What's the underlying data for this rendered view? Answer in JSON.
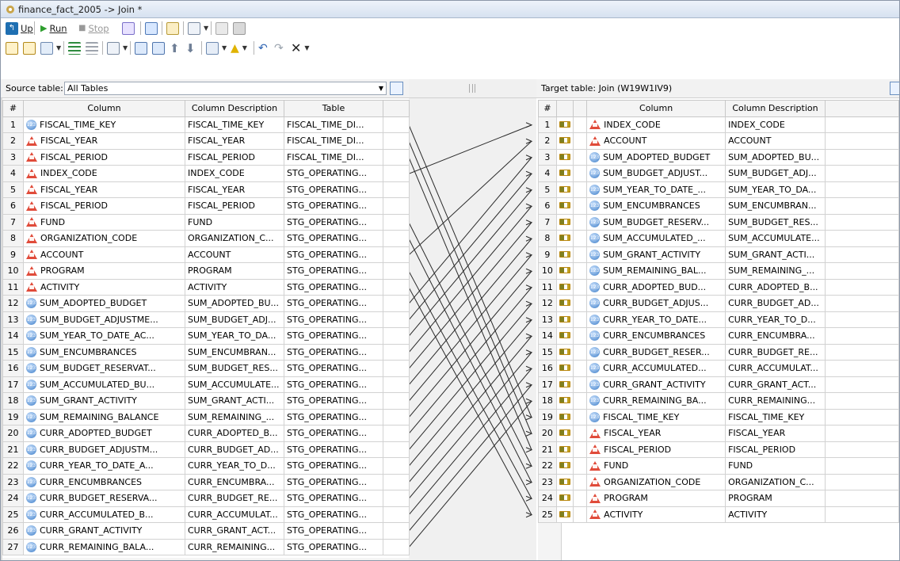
{
  "window": {
    "title": "finance_fact_2005 -> Join *"
  },
  "toolbar1": {
    "up": "Up",
    "run": "Run",
    "stop": "Stop"
  },
  "source": {
    "label": "Source table:",
    "value": "All Tables"
  },
  "target": {
    "label": "Target table:",
    "value": "Join (W19W1IV9)"
  },
  "left_headers": [
    "#",
    "Column",
    "Column Description",
    "Table"
  ],
  "right_headers": [
    "#",
    "",
    "",
    "Column",
    "Column Description"
  ],
  "left_rows": [
    {
      "n": "1",
      "icon": "numeric-icon",
      "col": "FISCAL_TIME_KEY",
      "desc": "FISCAL_TIME_KEY",
      "table": "FISCAL_TIME_DI..."
    },
    {
      "n": "2",
      "icon": "char-icon",
      "col": "FISCAL_YEAR",
      "desc": "FISCAL_YEAR",
      "table": "FISCAL_TIME_DI..."
    },
    {
      "n": "3",
      "icon": "char-icon",
      "col": "FISCAL_PERIOD",
      "desc": "FISCAL_PERIOD",
      "table": "FISCAL_TIME_DI..."
    },
    {
      "n": "4",
      "icon": "char-icon",
      "col": "INDEX_CODE",
      "desc": "INDEX_CODE",
      "table": "STG_OPERATING..."
    },
    {
      "n": "5",
      "icon": "char-icon",
      "col": "FISCAL_YEAR",
      "desc": "FISCAL_YEAR",
      "table": "STG_OPERATING..."
    },
    {
      "n": "6",
      "icon": "char-icon",
      "col": "FISCAL_PERIOD",
      "desc": "FISCAL_PERIOD",
      "table": "STG_OPERATING..."
    },
    {
      "n": "7",
      "icon": "char-icon",
      "col": "FUND",
      "desc": "FUND",
      "table": "STG_OPERATING..."
    },
    {
      "n": "8",
      "icon": "char-icon",
      "col": "ORGANIZATION_CODE",
      "desc": "ORGANIZATION_C...",
      "table": "STG_OPERATING..."
    },
    {
      "n": "9",
      "icon": "char-icon",
      "col": "ACCOUNT",
      "desc": "ACCOUNT",
      "table": "STG_OPERATING..."
    },
    {
      "n": "10",
      "icon": "char-icon",
      "col": "PROGRAM",
      "desc": "PROGRAM",
      "table": "STG_OPERATING..."
    },
    {
      "n": "11",
      "icon": "char-icon",
      "col": "ACTIVITY",
      "desc": "ACTIVITY",
      "table": "STG_OPERATING..."
    },
    {
      "n": "12",
      "icon": "numeric-icon",
      "col": "SUM_ADOPTED_BUDGET",
      "desc": "SUM_ADOPTED_BU...",
      "table": "STG_OPERATING..."
    },
    {
      "n": "13",
      "icon": "numeric-icon",
      "col": "SUM_BUDGET_ADJUSTME...",
      "desc": "SUM_BUDGET_ADJ...",
      "table": "STG_OPERATING..."
    },
    {
      "n": "14",
      "icon": "numeric-icon",
      "col": "SUM_YEAR_TO_DATE_AC...",
      "desc": "SUM_YEAR_TO_DA...",
      "table": "STG_OPERATING..."
    },
    {
      "n": "15",
      "icon": "numeric-icon",
      "col": "SUM_ENCUMBRANCES",
      "desc": "SUM_ENCUMBRAN...",
      "table": "STG_OPERATING..."
    },
    {
      "n": "16",
      "icon": "numeric-icon",
      "col": "SUM_BUDGET_RESERVAT...",
      "desc": "SUM_BUDGET_RES...",
      "table": "STG_OPERATING..."
    },
    {
      "n": "17",
      "icon": "numeric-icon",
      "col": "SUM_ACCUMULATED_BU...",
      "desc": "SUM_ACCUMULATE...",
      "table": "STG_OPERATING..."
    },
    {
      "n": "18",
      "icon": "numeric-icon",
      "col": "SUM_GRANT_ACTIVITY",
      "desc": "SUM_GRANT_ACTI...",
      "table": "STG_OPERATING..."
    },
    {
      "n": "19",
      "icon": "numeric-icon",
      "col": "SUM_REMAINING_BALANCE",
      "desc": "SUM_REMAINING_...",
      "table": "STG_OPERATING..."
    },
    {
      "n": "20",
      "icon": "numeric-icon",
      "col": "CURR_ADOPTED_BUDGET",
      "desc": "CURR_ADOPTED_B...",
      "table": "STG_OPERATING..."
    },
    {
      "n": "21",
      "icon": "numeric-icon",
      "col": "CURR_BUDGET_ADJUSTM...",
      "desc": "CURR_BUDGET_AD...",
      "table": "STG_OPERATING..."
    },
    {
      "n": "22",
      "icon": "numeric-icon",
      "col": "CURR_YEAR_TO_DATE_A...",
      "desc": "CURR_YEAR_TO_D...",
      "table": "STG_OPERATING..."
    },
    {
      "n": "23",
      "icon": "numeric-icon",
      "col": "CURR_ENCUMBRANCES",
      "desc": "CURR_ENCUMBRA...",
      "table": "STG_OPERATING..."
    },
    {
      "n": "24",
      "icon": "numeric-icon",
      "col": "CURR_BUDGET_RESERVA...",
      "desc": "CURR_BUDGET_RE...",
      "table": "STG_OPERATING..."
    },
    {
      "n": "25",
      "icon": "numeric-icon",
      "col": "CURR_ACCUMULATED_B...",
      "desc": "CURR_ACCUMULAT...",
      "table": "STG_OPERATING..."
    },
    {
      "n": "26",
      "icon": "numeric-icon",
      "col": "CURR_GRANT_ACTIVITY",
      "desc": "CURR_GRANT_ACT...",
      "table": "STG_OPERATING..."
    },
    {
      "n": "27",
      "icon": "numeric-icon",
      "col": "CURR_REMAINING_BALA...",
      "desc": "CURR_REMAINING...",
      "table": "STG_OPERATING..."
    }
  ],
  "right_rows": [
    {
      "n": "1",
      "icon": "char-icon",
      "col": "INDEX_CODE",
      "desc": "INDEX_CODE"
    },
    {
      "n": "2",
      "icon": "char-icon",
      "col": "ACCOUNT",
      "desc": "ACCOUNT"
    },
    {
      "n": "3",
      "icon": "numeric-icon",
      "col": "SUM_ADOPTED_BUDGET",
      "desc": "SUM_ADOPTED_BU..."
    },
    {
      "n": "4",
      "icon": "numeric-icon",
      "col": "SUM_BUDGET_ADJUST...",
      "desc": "SUM_BUDGET_ADJ..."
    },
    {
      "n": "5",
      "icon": "numeric-icon",
      "col": "SUM_YEAR_TO_DATE_...",
      "desc": "SUM_YEAR_TO_DA..."
    },
    {
      "n": "6",
      "icon": "numeric-icon",
      "col": "SUM_ENCUMBRANCES",
      "desc": "SUM_ENCUMBRAN..."
    },
    {
      "n": "7",
      "icon": "numeric-icon",
      "col": "SUM_BUDGET_RESERV...",
      "desc": "SUM_BUDGET_RES..."
    },
    {
      "n": "8",
      "icon": "numeric-icon",
      "col": "SUM_ACCUMULATED_...",
      "desc": "SUM_ACCUMULATE..."
    },
    {
      "n": "9",
      "icon": "numeric-icon",
      "col": "SUM_GRANT_ACTIVITY",
      "desc": "SUM_GRANT_ACTI..."
    },
    {
      "n": "10",
      "icon": "numeric-icon",
      "col": "SUM_REMAINING_BAL...",
      "desc": "SUM_REMAINING_..."
    },
    {
      "n": "11",
      "icon": "numeric-icon",
      "col": "CURR_ADOPTED_BUD...",
      "desc": "CURR_ADOPTED_B..."
    },
    {
      "n": "12",
      "icon": "numeric-icon",
      "col": "CURR_BUDGET_ADJUS...",
      "desc": "CURR_BUDGET_AD..."
    },
    {
      "n": "13",
      "icon": "numeric-icon",
      "col": "CURR_YEAR_TO_DATE...",
      "desc": "CURR_YEAR_TO_D..."
    },
    {
      "n": "14",
      "icon": "numeric-icon",
      "col": "CURR_ENCUMBRANCES",
      "desc": "CURR_ENCUMBRA..."
    },
    {
      "n": "15",
      "icon": "numeric-icon",
      "col": "CURR_BUDGET_RESER...",
      "desc": "CURR_BUDGET_RE..."
    },
    {
      "n": "16",
      "icon": "numeric-icon",
      "col": "CURR_ACCUMULATED...",
      "desc": "CURR_ACCUMULAT..."
    },
    {
      "n": "17",
      "icon": "numeric-icon",
      "col": "CURR_GRANT_ACTIVITY",
      "desc": "CURR_GRANT_ACT..."
    },
    {
      "n": "18",
      "icon": "numeric-icon",
      "col": "CURR_REMAINING_BA...",
      "desc": "CURR_REMAINING..."
    },
    {
      "n": "19",
      "icon": "numeric-icon",
      "col": "FISCAL_TIME_KEY",
      "desc": "FISCAL_TIME_KEY"
    },
    {
      "n": "20",
      "icon": "char-icon",
      "col": "FISCAL_YEAR",
      "desc": "FISCAL_YEAR"
    },
    {
      "n": "21",
      "icon": "char-icon",
      "col": "FISCAL_PERIOD",
      "desc": "FISCAL_PERIOD"
    },
    {
      "n": "22",
      "icon": "char-icon",
      "col": "FUND",
      "desc": "FUND"
    },
    {
      "n": "23",
      "icon": "char-icon",
      "col": "ORGANIZATION_CODE",
      "desc": "ORGANIZATION_C..."
    },
    {
      "n": "24",
      "icon": "char-icon",
      "col": "PROGRAM",
      "desc": "PROGRAM"
    },
    {
      "n": "25",
      "icon": "char-icon",
      "col": "ACTIVITY",
      "desc": "ACTIVITY"
    }
  ],
  "mappings": [
    [
      1,
      19
    ],
    [
      2,
      20
    ],
    [
      3,
      21
    ],
    [
      4,
      1
    ],
    [
      7,
      22
    ],
    [
      8,
      23
    ],
    [
      9,
      2
    ],
    [
      10,
      24
    ],
    [
      11,
      25
    ],
    [
      12,
      3
    ],
    [
      13,
      4
    ],
    [
      14,
      5
    ],
    [
      15,
      6
    ],
    [
      16,
      7
    ],
    [
      17,
      8
    ],
    [
      18,
      9
    ],
    [
      19,
      10
    ],
    [
      20,
      11
    ],
    [
      21,
      12
    ],
    [
      22,
      13
    ],
    [
      23,
      14
    ],
    [
      24,
      15
    ],
    [
      25,
      16
    ],
    [
      26,
      17
    ],
    [
      27,
      18
    ]
  ],
  "colors": {
    "mapping_line": "#2a2a2a",
    "char_icon": "#e04b3a",
    "numeric_icon": "#3b7cc7"
  }
}
